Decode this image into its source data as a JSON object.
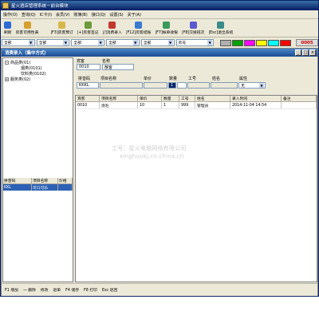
{
  "app": {
    "title": "星火酒店管理系统－前台模块",
    "menu": [
      "操作(O)",
      "查询(Q)",
      "IC卡(I)",
      "会员(V)",
      "账簿(B)",
      "接口(Q)",
      "设置(S)",
      "关于(A)"
    ]
  },
  "toolbar": {
    "buttons": [
      {
        "label": "刷新",
        "icon": "refresh-icon",
        "color": "#2f6bd6"
      },
      {
        "label": "房客可用性表",
        "icon": "table-icon",
        "color": "#d6a02f"
      },
      {
        "label": "|F3]房客预订",
        "icon": "book-icon",
        "color": "#d6b84a"
      },
      {
        "label": "|+]房客签记",
        "icon": "sign-icon",
        "color": "#6b9a3a"
      },
      {
        "label": "|/]消费录入",
        "icon": "cart-icon",
        "color": "#c0392b"
      },
      {
        "label": "|F12]房客结账",
        "icon": "checkout-icon",
        "color": "#3a7ad0"
      },
      {
        "label": "|F7]帐单收银",
        "icon": "cash-icon",
        "color": "#3a9a5a"
      },
      {
        "label": "|F8]交接班次",
        "icon": "shift-icon",
        "color": "#5a5ad0"
      },
      {
        "label": "|Esc]退出系统",
        "icon": "exit-icon",
        "color": "#3a8a8a"
      }
    ]
  },
  "filters": {
    "selects": [
      "全部",
      "全部",
      "全部",
      "全部",
      "全部"
    ],
    "room_field": "房号",
    "swatches": [
      "#b0b0b0",
      "#00a000",
      "#ff00ff",
      "#ffff00",
      "#00ffff",
      "#ff0000"
    ],
    "counter": "0005"
  },
  "window": {
    "title": "消费录入（集中方式）",
    "controls": [
      "_",
      "□",
      "×"
    ]
  },
  "tree": {
    "groups": [
      {
        "label": "商品类(01)",
        "children": [
          "烟类(0101)",
          "饮料类(0102)"
        ]
      },
      {
        "label": "服务类(02)",
        "children": []
      }
    ]
  },
  "left_table": {
    "columns": [
      "拼音码",
      "项目名称",
      "价格"
    ],
    "rows": [
      [
        "KKL",
        "可口可乐",
        ""
      ]
    ]
  },
  "form": {
    "guest_label": "宾客",
    "guest_code": "0010",
    "name_label": "名称",
    "name_value": "散客",
    "pinyin_label": "拼音码",
    "item_label": "项目名称",
    "price_label": "单价",
    "qty_label": "数量",
    "staff_label": "工号",
    "staff_name_label": "姓名",
    "attr_label": "属性",
    "pinyin_value": "KKKL",
    "qty_value": "1",
    "attr_value": "无"
  },
  "grid": {
    "columns": [
      "宾客",
      "项目名称",
      "单价",
      "数量",
      "工号",
      "姓名",
      "录入时间",
      "备注"
    ],
    "rows": [
      [
        "0010",
        "烧毛",
        "10",
        "1",
        "999",
        "管理员",
        "2014-11-04 14:54",
        ""
      ]
    ]
  },
  "statusbar": {
    "items": [
      "F1 增加",
      "一 删除",
      "修改",
      "退单",
      "F4 储存",
      "F8 打印",
      "Esc 退回"
    ]
  },
  "watermark": {
    "line1": "工号：星火电脑网络有限公司",
    "line2": "xinghuokj.cn.china.cn"
  }
}
